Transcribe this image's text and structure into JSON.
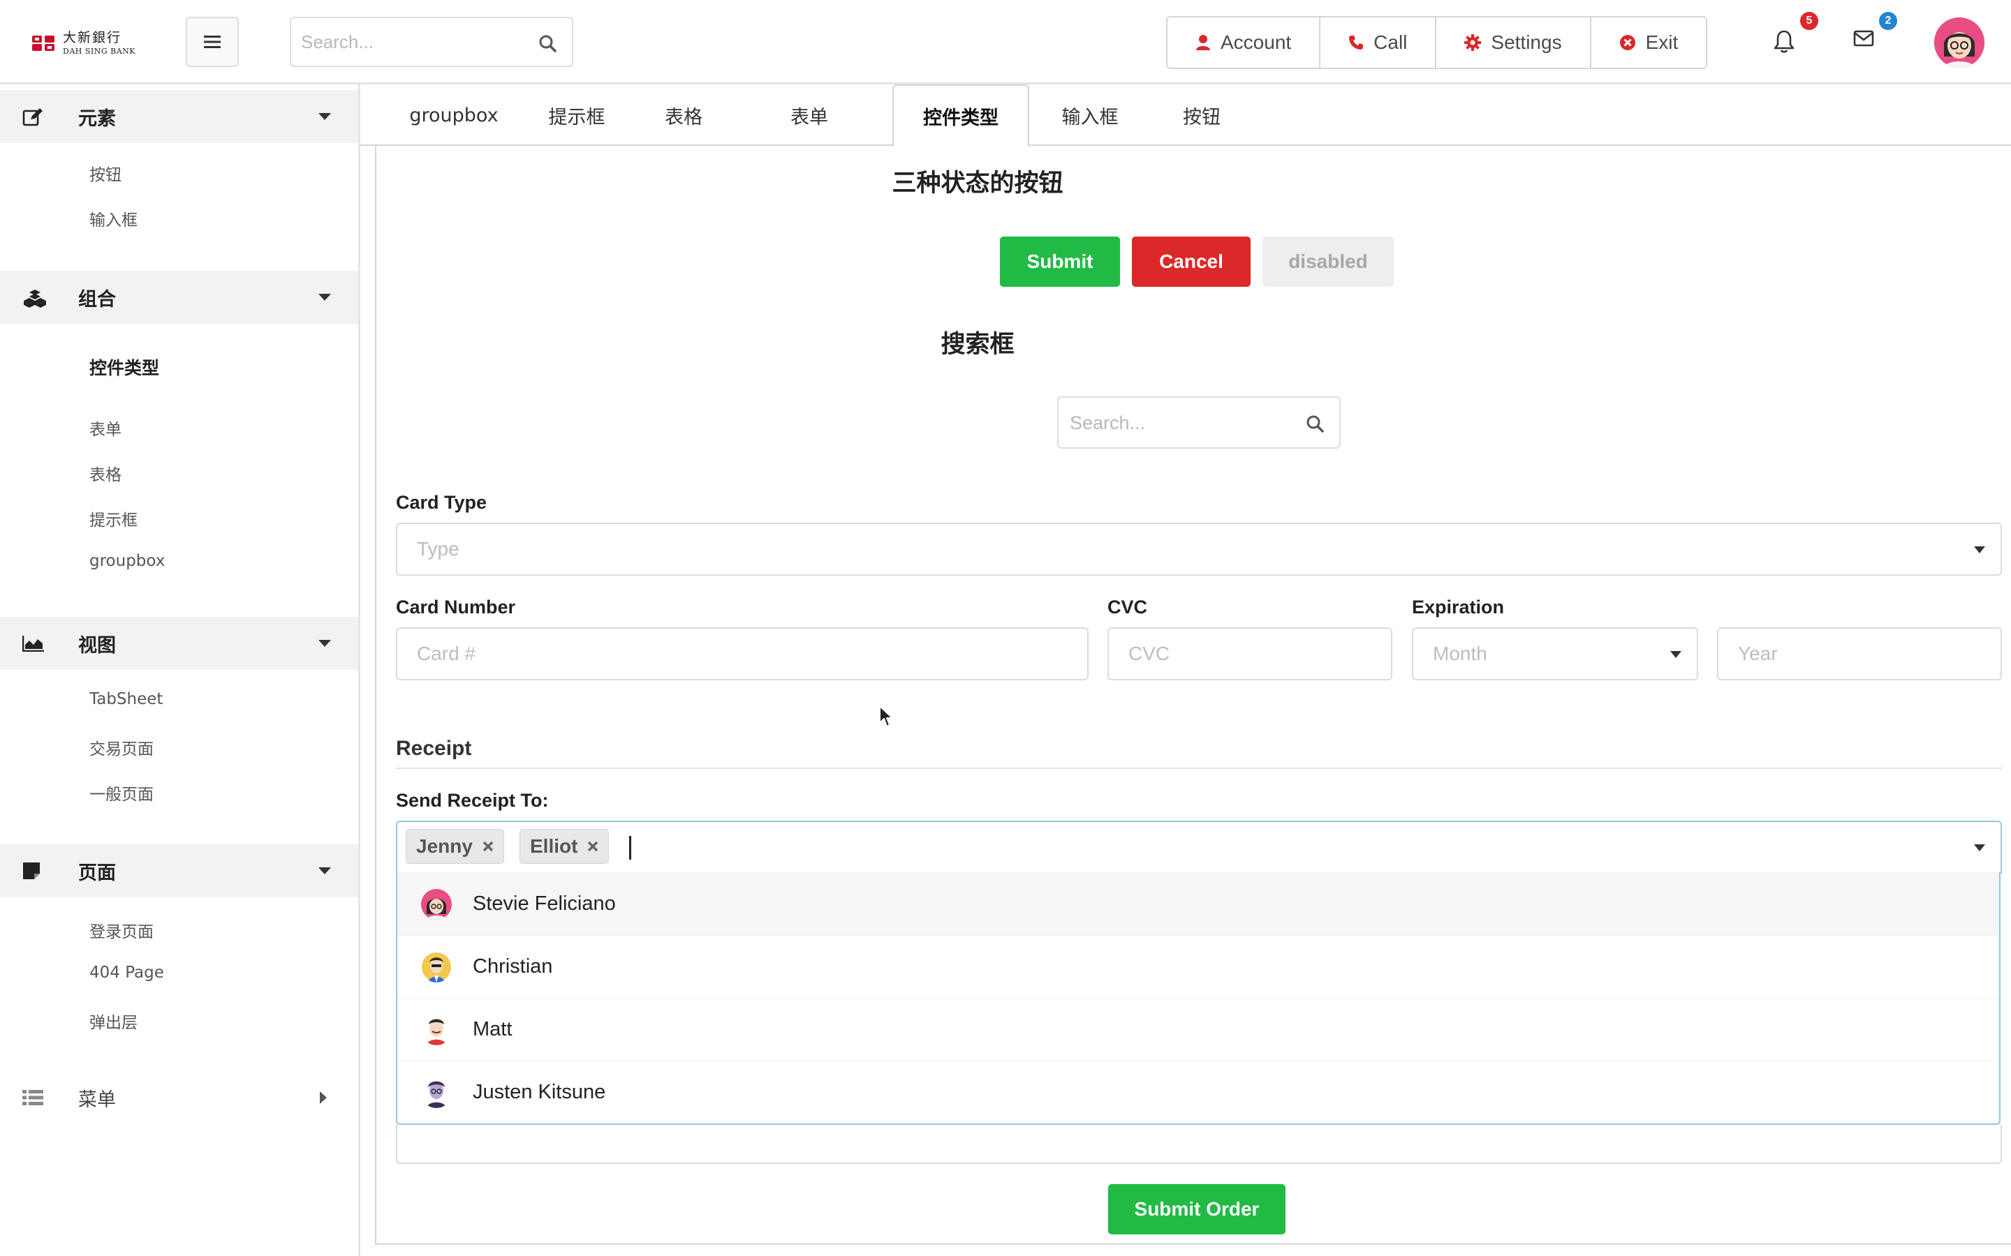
{
  "header": {
    "logo_cn": "大新銀行",
    "logo_en": "DAH SING BANK",
    "search_placeholder": "Search...",
    "buttons": [
      {
        "label": "Account",
        "icon": "user-icon",
        "color": "#db2828"
      },
      {
        "label": "Call",
        "icon": "phone-icon",
        "color": "#db2828"
      },
      {
        "label": "Settings",
        "icon": "gear-icon",
        "color": "#db2828"
      },
      {
        "label": "Exit",
        "icon": "close-circle-icon",
        "color": "#db2828"
      }
    ],
    "notifications_count": "5",
    "messages_count": "2"
  },
  "sidebar": {
    "sections": [
      {
        "label": "元素",
        "icon": "edit-icon",
        "items": [
          "按钮",
          "输入框"
        ]
      },
      {
        "label": "组合",
        "icon": "cubes-icon",
        "items": [
          "控件类型",
          "表单",
          "表格",
          "提示框",
          "groupbox"
        ],
        "active_item": "控件类型"
      },
      {
        "label": "视图",
        "icon": "area-chart-icon",
        "items": [
          "TabSheet",
          "交易页面",
          "一般页面"
        ]
      },
      {
        "label": "页面",
        "icon": "sticky-note-icon",
        "items": [
          "登录页面",
          "404 Page",
          "弹出层"
        ]
      },
      {
        "label": "菜单",
        "icon": "list-icon",
        "items": []
      }
    ]
  },
  "tabs": [
    "groupbox",
    "提示框",
    "表格",
    "表单",
    "控件类型",
    "输入框",
    "按钮"
  ],
  "active_tab": "控件类型",
  "main": {
    "buttons_title": "三种状态的按钮",
    "submit_label": "Submit",
    "cancel_label": "Cancel",
    "disabled_label": "disabled",
    "search_title": "搜索框",
    "search_placeholder": "Search...",
    "card_type_label": "Card Type",
    "card_type_placeholder": "Type",
    "card_number_label": "Card Number",
    "card_number_placeholder": "Card #",
    "cvc_label": "CVC",
    "cvc_placeholder": "CVC",
    "expiration_label": "Expiration",
    "month_placeholder": "Month",
    "year_placeholder": "Year",
    "receipt_title": "Receipt",
    "send_receipt_label": "Send Receipt To:",
    "chips": [
      "Jenny",
      "Elliot"
    ],
    "dropdown_options": [
      "Stevie Feliciano",
      "Christian",
      "Matt",
      "Justen Kitsune"
    ],
    "submit_order_label": "Submit Order"
  },
  "colors": {
    "green": "#21ba45",
    "red": "#db2828",
    "focus_border": "#96c8da",
    "badge_blue": "#2185d0"
  }
}
